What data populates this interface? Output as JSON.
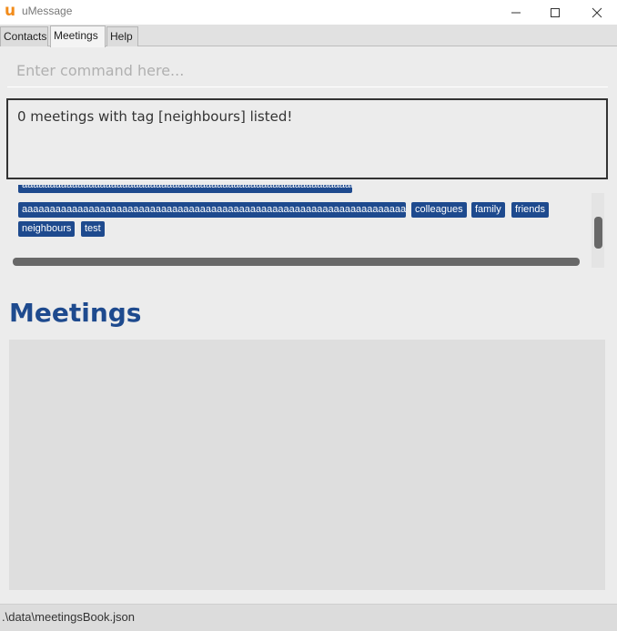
{
  "window": {
    "title": "uMessage",
    "logo_letter": "u",
    "logo_color": "#f28c1b"
  },
  "tabs": [
    {
      "label": "Contacts",
      "active": false
    },
    {
      "label": "Meetings",
      "active": true
    },
    {
      "label": "Help",
      "active": false
    }
  ],
  "command": {
    "placeholder": "Enter command here...",
    "value": ""
  },
  "result": {
    "text": "0 meetings with tag [neighbours] listed!"
  },
  "tags": {
    "top_partial": "aaaaaaaaaaaaaaaaaaaaaaaaaaaaaaaaaaaaaaaaaaaaaaaaaaaaaaaaaaaaaaaa",
    "long": "aaaaaaaaaaaaaaaaaaaaaaaaaaaaaaaaaaaaaaaaaaaaaaaaaaaaaaaaaaaaaaaaaaaaaaaaaaa",
    "colleagues": "colleagues",
    "family": "family",
    "friends": "friends",
    "neighbours": "neighbours",
    "test": "test"
  },
  "meetings": {
    "title": "Meetings",
    "items": []
  },
  "status_bar": {
    "path": ".\\data\\meetingsBook.json"
  },
  "colors": {
    "accent": "#1e4a8e",
    "background": "#ececec",
    "list_background": "#dedede"
  },
  "icons": [
    "app-logo-icon",
    "minimize-icon",
    "maximize-icon",
    "close-icon"
  ]
}
